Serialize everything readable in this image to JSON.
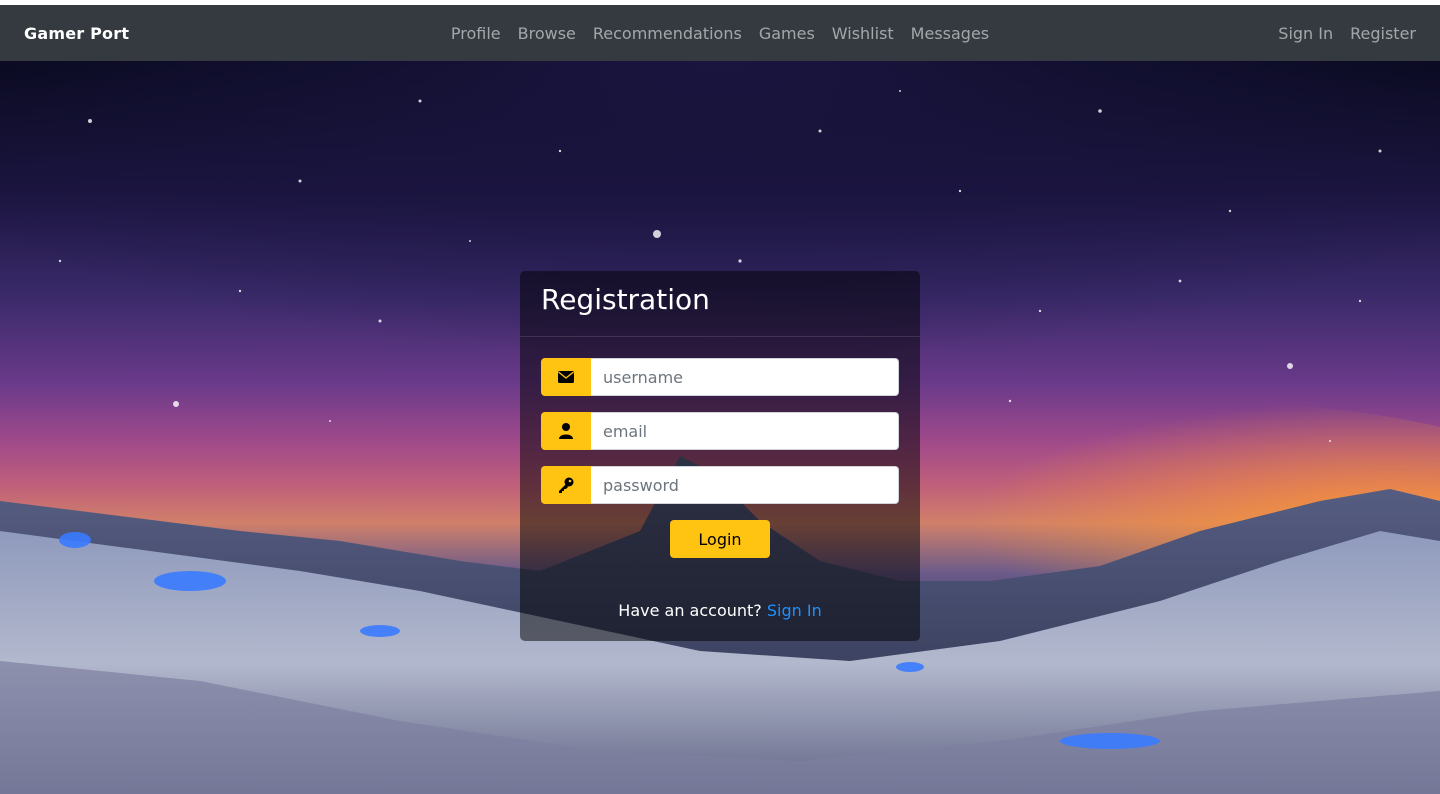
{
  "navbar": {
    "brand": "Gamer Port",
    "links": [
      "Profile",
      "Browse",
      "Recommendations",
      "Games",
      "Wishlist",
      "Messages"
    ],
    "right_links": [
      "Sign In",
      "Register"
    ]
  },
  "form": {
    "title": "Registration",
    "fields": [
      {
        "placeholder": "username",
        "icon": "envelope-icon"
      },
      {
        "placeholder": "email",
        "icon": "user-icon"
      },
      {
        "placeholder": "password",
        "icon": "key-icon"
      }
    ],
    "submit_label": "Login",
    "footer_text": "Have an account?",
    "footer_link": "Sign In"
  },
  "colors": {
    "navbar_bg": "#343a40",
    "accent": "#ffc312",
    "link": "#1e90ff"
  }
}
